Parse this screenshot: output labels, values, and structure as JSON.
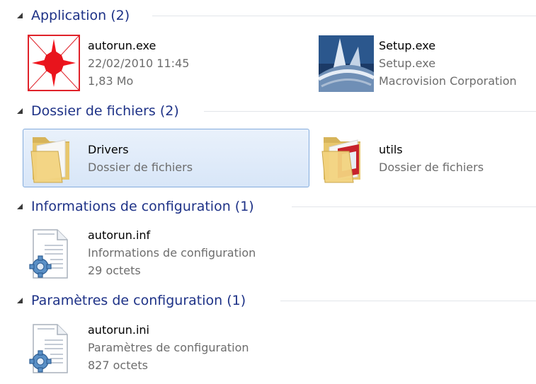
{
  "colors": {
    "group_title": "#1e3287",
    "separator": "#e2e5ea",
    "secondary_text": "#6d6d6d",
    "selection_fill": "#dde9f9",
    "selection_border": "#84acdd"
  },
  "groups": [
    {
      "title": "Application (2)",
      "items": [
        {
          "name": "autorun.exe",
          "line2": "22/02/2010 11:45",
          "line3": "1,83 Mo",
          "icon": "autorun-app-icon"
        },
        {
          "name": "Setup.exe",
          "line2": "Setup.exe",
          "line3": "Macrovision Corporation",
          "icon": "setup-installer-icon"
        }
      ]
    },
    {
      "title": "Dossier de fichiers (2)",
      "items": [
        {
          "name": "Drivers",
          "line2": "Dossier de fichiers",
          "icon": "folder-icon",
          "selected": true
        },
        {
          "name": "utils",
          "line2": "Dossier de fichiers",
          "icon": "folder-with-documents-icon"
        }
      ]
    },
    {
      "title": "Informations de configuration (1)",
      "items": [
        {
          "name": "autorun.inf",
          "line2": "Informations de configuration",
          "line3": "29 octets",
          "icon": "config-file-icon"
        }
      ]
    },
    {
      "title": "Paramètres de configuration (1)",
      "items": [
        {
          "name": "autorun.ini",
          "line2": "Paramètres de configuration",
          "line3": "827 octets",
          "icon": "config-file-icon"
        }
      ]
    }
  ]
}
